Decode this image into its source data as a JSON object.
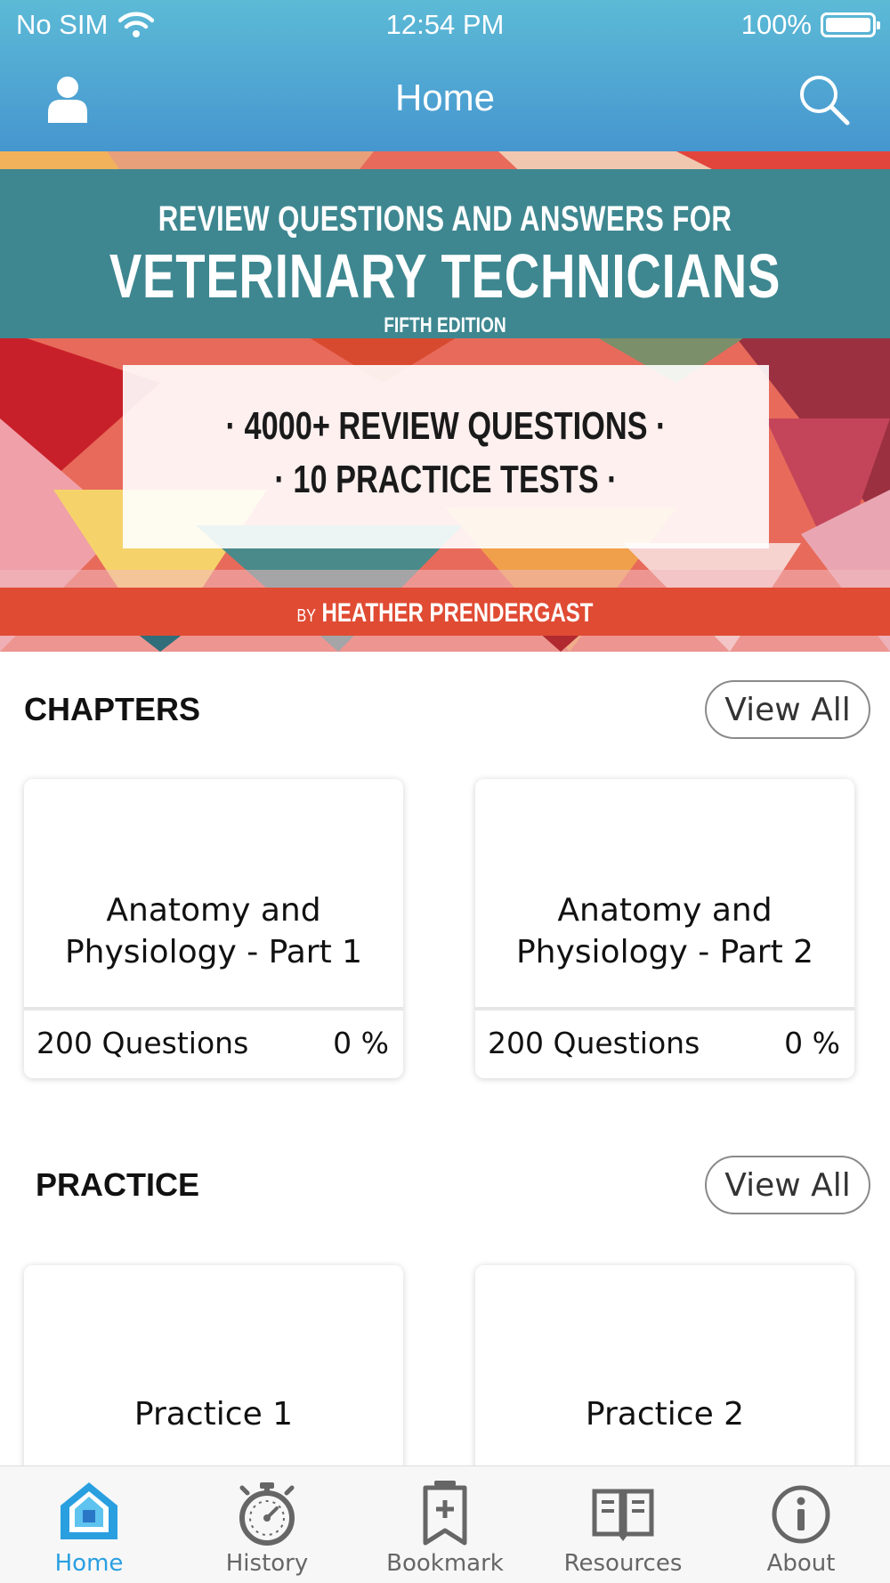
{
  "status_bar": {
    "carrier": "No SIM",
    "time": "12:54 PM",
    "battery": "100%"
  },
  "nav": {
    "title": "Home"
  },
  "banner": {
    "line1": "REVIEW QUESTIONS AND ANSWERS FOR",
    "line2": "VETERINARY TECHNICIANS",
    "edition": "FIFTH EDITION",
    "feature1": "· 4000+ REVIEW QUESTIONS ·",
    "feature2": "· 10 PRACTICE TESTS ·",
    "by": "BY",
    "author": "HEATHER PRENDERGAST"
  },
  "chapters": {
    "title": "CHAPTERS",
    "view_all": "View All",
    "items": [
      {
        "title": "Anatomy and Physiology - Part 1",
        "questions": "200 Questions",
        "percent": "0 %"
      },
      {
        "title": "Anatomy and Physiology - Part 2",
        "questions": "200 Questions",
        "percent": "0 %"
      }
    ]
  },
  "practice": {
    "title": "PRACTICE",
    "view_all": "View All",
    "items": [
      {
        "title": "Practice 1"
      },
      {
        "title": "Practice 2"
      }
    ]
  },
  "tabs": [
    {
      "label": "Home",
      "icon": "home-icon",
      "active": true
    },
    {
      "label": "History",
      "icon": "stopwatch-icon",
      "active": false
    },
    {
      "label": "Bookmark",
      "icon": "bookmark-icon",
      "active": false
    },
    {
      "label": "Resources",
      "icon": "book-icon",
      "active": false
    },
    {
      "label": "About",
      "icon": "info-icon",
      "active": false
    }
  ],
  "colors": {
    "header_top": "#5cbad6",
    "header_bottom": "#4696cf",
    "tab_active": "#2a9fe0",
    "banner_band": "#3e8790",
    "banner_author": "#e04b33"
  }
}
